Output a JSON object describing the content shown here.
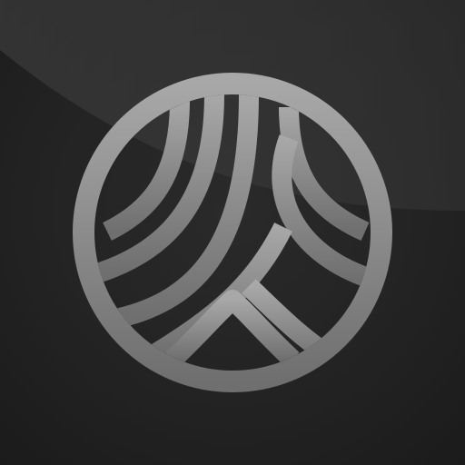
{
  "icon": {
    "name": "abstract-circle-logo",
    "colors": {
      "background": "#222222",
      "highlight": "#3a3a3a",
      "ring": "#8f8f8f",
      "stroke_top": "#a8a8a8",
      "stroke_bottom": "#6f6f6f"
    }
  }
}
